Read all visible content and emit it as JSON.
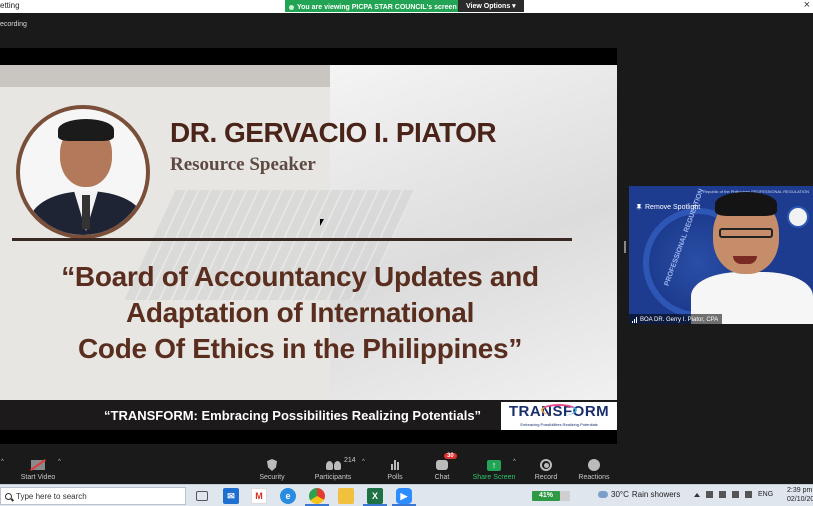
{
  "titlebar": {
    "title": "etting",
    "close_glyph": "×"
  },
  "share_banner": {
    "text": "You are viewing PICPA STAR COUNCIL's screen",
    "view_options": "View Options ▾"
  },
  "meeting": {
    "recording_label": "ecording"
  },
  "slide": {
    "speaker_name": "DR. GERVACIO I. PIATOR",
    "speaker_role": "Resource Speaker",
    "talk_title_lines": [
      "“Board of Accountancy Updates and",
      "Adaptation of International",
      "Code Of Ethics in the Philippines”"
    ],
    "theme": "“TRANSFORM: Embracing Possibilities Realizing Potentials”",
    "logo_word": "TRANSFORM",
    "logo_sub": "Embracing Possibilities Realizing Potentials",
    "colors": {
      "name": "#4a2418",
      "title": "#5a2e1e",
      "theme_bar": "#1c1a1a"
    }
  },
  "video_tile": {
    "remove_spotlight": "Remove Spotlight",
    "participant_name": "BOA DR. Gerry I. Piator, CPA",
    "seal_text": "PROFESSIONAL REGULATION",
    "top_text": "Republic of the Philippines PROFESSIONAL REGULATION",
    "accent_color": "#1d3c8f"
  },
  "toolbar": {
    "start_video": "Start Video",
    "security": "Security",
    "participants": "Participants",
    "participants_count": "214",
    "polls": "Polls",
    "chat": "Chat",
    "chat_badge": "30",
    "share_screen": "Share Screen",
    "record": "Record",
    "reactions": "Reactions",
    "caret": "^"
  },
  "taskbar": {
    "search_placeholder": "Type here to search",
    "battery": "41%",
    "weather_temp": "30°C",
    "weather_desc": "Rain showers",
    "language": "ENG",
    "time": "2:39 pm",
    "date": "02/10/20"
  }
}
